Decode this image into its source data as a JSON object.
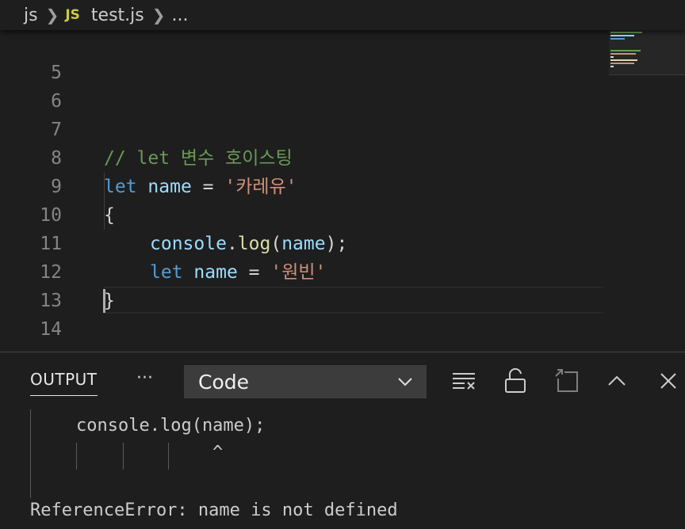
{
  "breadcrumb": {
    "folder": "js",
    "file_badge": "JS",
    "file": "test.js",
    "ellipsis": "..."
  },
  "editor": {
    "lines": [
      {
        "number": "5"
      },
      {
        "number": "6"
      },
      {
        "number": "7",
        "comment": "// let 변수 호이스팅"
      },
      {
        "number": "8",
        "keyword": "let",
        "name": "name",
        "op": " = ",
        "string": "'카레유'"
      },
      {
        "number": "9",
        "brace": "{"
      },
      {
        "number": "10",
        "object": "console",
        "dot": ".",
        "method": "log",
        "open": "(",
        "arg": "name",
        "close": ");"
      },
      {
        "number": "11",
        "keyword": "let",
        "name": "name",
        "op": " = ",
        "string": "'원빈'"
      },
      {
        "number": "12",
        "brace": "}"
      },
      {
        "number": "13"
      },
      {
        "number": "14"
      }
    ]
  },
  "panel": {
    "tab_label": "OUTPUT",
    "more_label": "···",
    "channel_selected": "Code",
    "icons": [
      "clear-output-icon",
      "lock-scroll-icon",
      "open-editor-icon",
      "maximize-panel-icon",
      "close-panel-icon"
    ]
  },
  "output": {
    "code_line": "console.log(name);",
    "caret": "^",
    "error": "ReferenceError: name is not defined"
  },
  "colors": {
    "background": "#1e1e1e",
    "comment": "#6a9955",
    "keyword": "#569cd6",
    "variable": "#9cdcfe",
    "string": "#ce9178",
    "function": "#dcdcaa",
    "line_number": "#858585"
  }
}
